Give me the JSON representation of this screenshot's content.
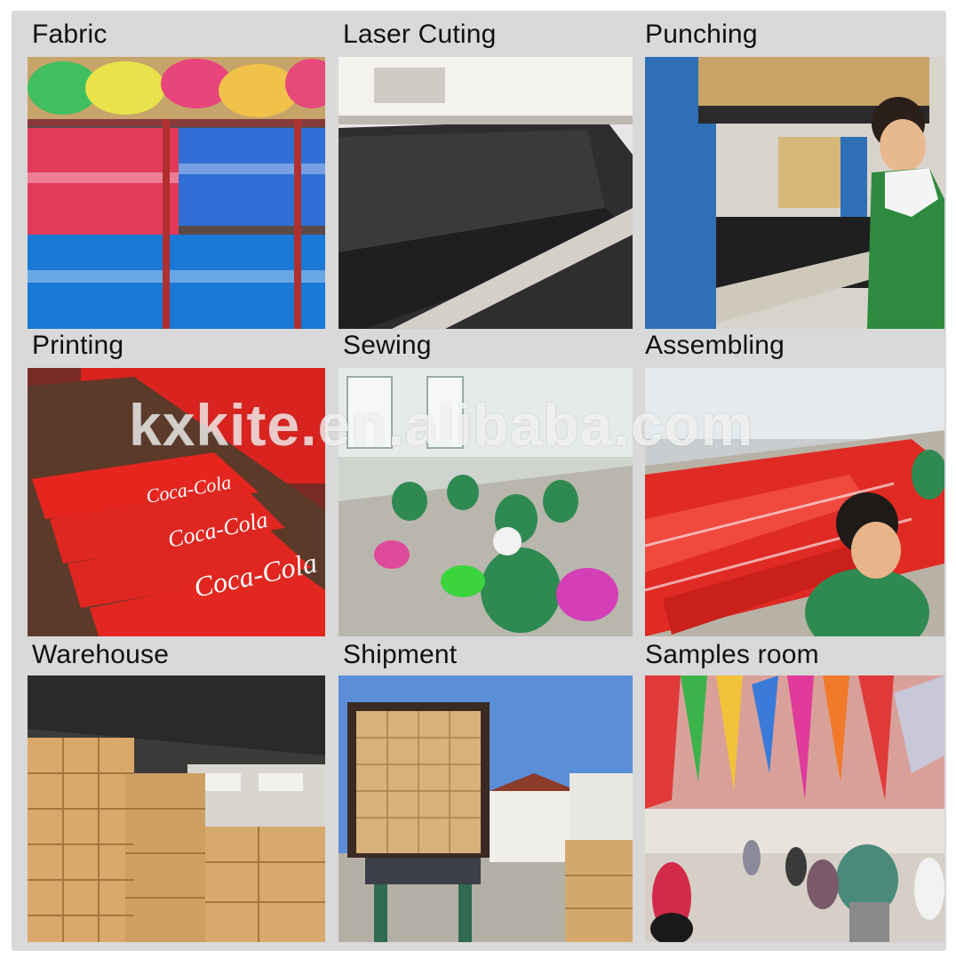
{
  "panels": [
    {
      "label": "Fabric"
    },
    {
      "label": "Laser Cuting"
    },
    {
      "label": "Punching"
    },
    {
      "label": "Printing"
    },
    {
      "label": "Sewing"
    },
    {
      "label": "Assembling"
    },
    {
      "label": "Warehouse"
    },
    {
      "label": "Shipment"
    },
    {
      "label": "Samples room"
    }
  ],
  "watermark": "kxkite.en.alibaba.com",
  "printed_text": {
    "brand_on_banners": "Coca-Cola"
  },
  "colors": {
    "background": "#d9d9d9",
    "label_text": "#111111"
  }
}
